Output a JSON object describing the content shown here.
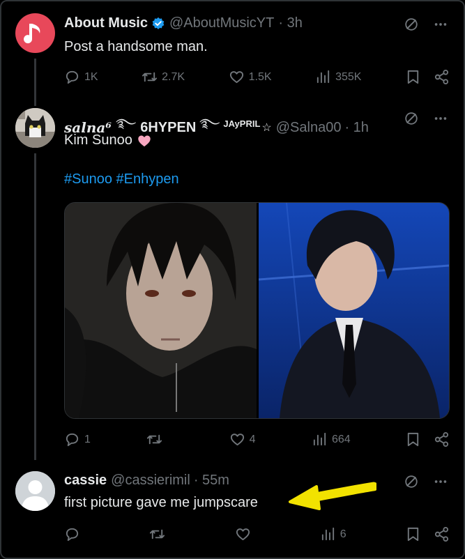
{
  "tweet1": {
    "name": "About Music",
    "handle": "@AboutMusicYT",
    "time": "· 3h",
    "text": "Post a handsome man.",
    "replies": "1K",
    "retweets": "2.7K",
    "likes": "1.5K",
    "views": "355K"
  },
  "tweet2": {
    "name_prefix": "salna⁶",
    "name_middle": "6HYPEN",
    "name_suffix": "JAyPRIL",
    "handle": "@Salna00",
    "time": "· 1h",
    "text": "Kim Sunoo",
    "hashtags": "#Sunoo #Enhypen",
    "replies": "1",
    "likes": "4",
    "views": "664"
  },
  "tweet3": {
    "name": "cassie",
    "handle": "@cassierimil",
    "time": "· 55m",
    "text": "first picture gave me jumpscare",
    "views": "6"
  },
  "colors": {
    "accent": "#1d9bf0",
    "arrow": "#f2e200",
    "heart": "#f7a7c0"
  }
}
